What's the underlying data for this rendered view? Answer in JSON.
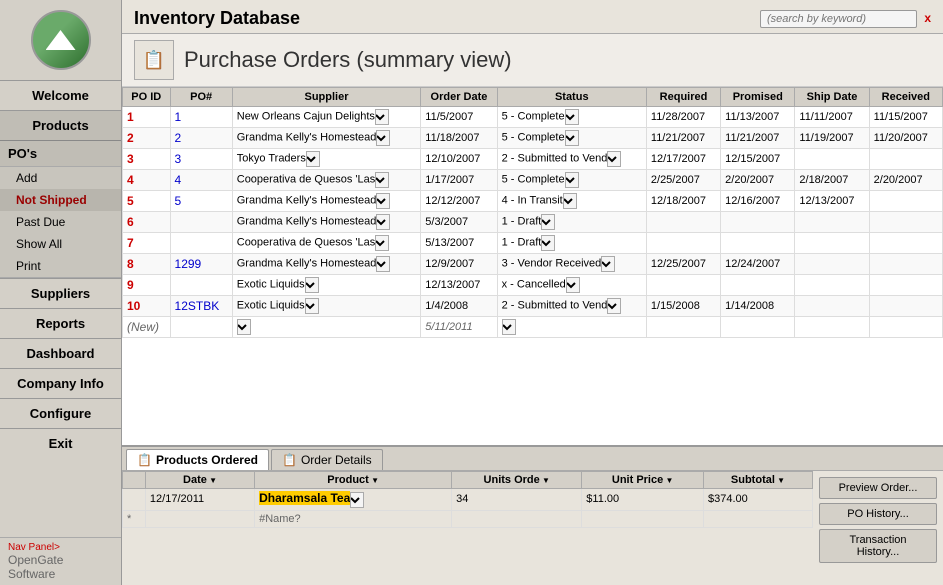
{
  "app": {
    "title": "Inventory Database",
    "search_placeholder": "(search by keyword)"
  },
  "page": {
    "title": "Purchase Orders (summary view)",
    "icon": "📋"
  },
  "sidebar": {
    "nav_items": [
      {
        "id": "welcome",
        "label": "Welcome"
      },
      {
        "id": "products",
        "label": "Products"
      }
    ],
    "pos_label": "PO's",
    "pos_sub": [
      {
        "id": "add",
        "label": "Add"
      },
      {
        "id": "not-shipped",
        "label": "Not Shipped",
        "active": true
      },
      {
        "id": "past-due",
        "label": "Past Due"
      },
      {
        "id": "show-all",
        "label": "Show All"
      },
      {
        "id": "print",
        "label": "Print"
      }
    ],
    "other_nav": [
      {
        "id": "suppliers",
        "label": "Suppliers"
      },
      {
        "id": "reports",
        "label": "Reports"
      },
      {
        "id": "dashboard",
        "label": "Dashboard"
      },
      {
        "id": "company-info",
        "label": "Company Info"
      },
      {
        "id": "configure",
        "label": "Configure"
      },
      {
        "id": "exit",
        "label": "Exit"
      }
    ],
    "nav_panel": "Nav Panel>",
    "footer": "OpenGate Software"
  },
  "table": {
    "headers": [
      "PO ID",
      "PO#",
      "Supplier",
      "Order Date",
      "Status",
      "Required",
      "Promised",
      "Ship Date",
      "Received"
    ],
    "rows": [
      {
        "poid": "1",
        "po": "1",
        "supplier": "New Orleans Cajun Delights",
        "order_date": "11/5/2007",
        "status": "5 - Complete",
        "required": "11/28/2007",
        "promised": "11/13/2007",
        "ship_date": "11/11/2007",
        "received": "11/15/2007"
      },
      {
        "poid": "2",
        "po": "2",
        "supplier": "Grandma Kelly's Homestead",
        "order_date": "11/18/2007",
        "status": "5 - Complete",
        "required": "11/21/2007",
        "promised": "11/21/2007",
        "ship_date": "11/19/2007",
        "received": "11/20/2007"
      },
      {
        "poid": "3",
        "po": "3",
        "supplier": "Tokyo Traders",
        "order_date": "12/10/2007",
        "status": "2 - Submitted to Vend",
        "required": "12/17/2007",
        "promised": "12/15/2007",
        "ship_date": "",
        "received": ""
      },
      {
        "poid": "4",
        "po": "4",
        "supplier": "Cooperativa de Quesos 'Las",
        "order_date": "1/17/2007",
        "status": "5 - Complete",
        "required": "2/25/2007",
        "promised": "2/20/2007",
        "ship_date": "2/18/2007",
        "received": "2/20/2007"
      },
      {
        "poid": "5",
        "po": "5",
        "supplier": "Grandma Kelly's Homestead",
        "order_date": "12/12/2007",
        "status": "4 - In Transit",
        "required": "12/18/2007",
        "promised": "12/16/2007",
        "ship_date": "12/13/2007",
        "received": ""
      },
      {
        "poid": "6",
        "po": "",
        "supplier": "Grandma Kelly's Homestead",
        "order_date": "5/3/2007",
        "status": "1 - Draft",
        "required": "",
        "promised": "",
        "ship_date": "",
        "received": ""
      },
      {
        "poid": "7",
        "po": "",
        "supplier": "Cooperativa de Quesos 'Las",
        "order_date": "5/13/2007",
        "status": "1 - Draft",
        "required": "",
        "promised": "",
        "ship_date": "",
        "received": ""
      },
      {
        "poid": "8",
        "po": "1299",
        "supplier": "Grandma Kelly's Homestead",
        "order_date": "12/9/2007",
        "status": "3 - Vendor Received",
        "required": "12/25/2007",
        "promised": "12/24/2007",
        "ship_date": "",
        "received": ""
      },
      {
        "poid": "9",
        "po": "",
        "supplier": "Exotic Liquids",
        "order_date": "12/13/2007",
        "status": "x - Cancelled",
        "required": "",
        "promised": "",
        "ship_date": "",
        "received": ""
      },
      {
        "poid": "10",
        "po": "12STBK",
        "supplier": "Exotic Liquids",
        "order_date": "1/4/2008",
        "status": "2 - Submitted to Vend",
        "required": "1/15/2008",
        "promised": "1/14/2008",
        "ship_date": "",
        "received": ""
      },
      {
        "poid": "(New)",
        "po": "",
        "supplier": "",
        "order_date": "5/11/2011",
        "status": "",
        "required": "",
        "promised": "",
        "ship_date": "",
        "received": ""
      }
    ]
  },
  "bottom": {
    "tabs": [
      {
        "id": "products-ordered",
        "label": "Products Ordered",
        "active": true,
        "icon": "📋"
      },
      {
        "id": "order-details",
        "label": "Order Details",
        "active": false,
        "icon": "📋"
      }
    ],
    "table_headers": [
      "",
      "Date",
      "Product",
      "Units Orde",
      "Unit Price",
      "Subtotal"
    ],
    "rows": [
      {
        "sel": "",
        "date": "12/17/2011",
        "product": "Dharamsala Tea",
        "units": "34",
        "unit_price": "$11.00",
        "subtotal": "$374.00"
      },
      {
        "sel": "*",
        "date": "",
        "product": "#Name?",
        "units": "",
        "unit_price": "",
        "subtotal": ""
      }
    ],
    "buttons": [
      {
        "id": "preview-order",
        "label": "Preview Order..."
      },
      {
        "id": "po-history",
        "label": "PO History..."
      },
      {
        "id": "transaction-history",
        "label": "Transaction History..."
      }
    ]
  }
}
